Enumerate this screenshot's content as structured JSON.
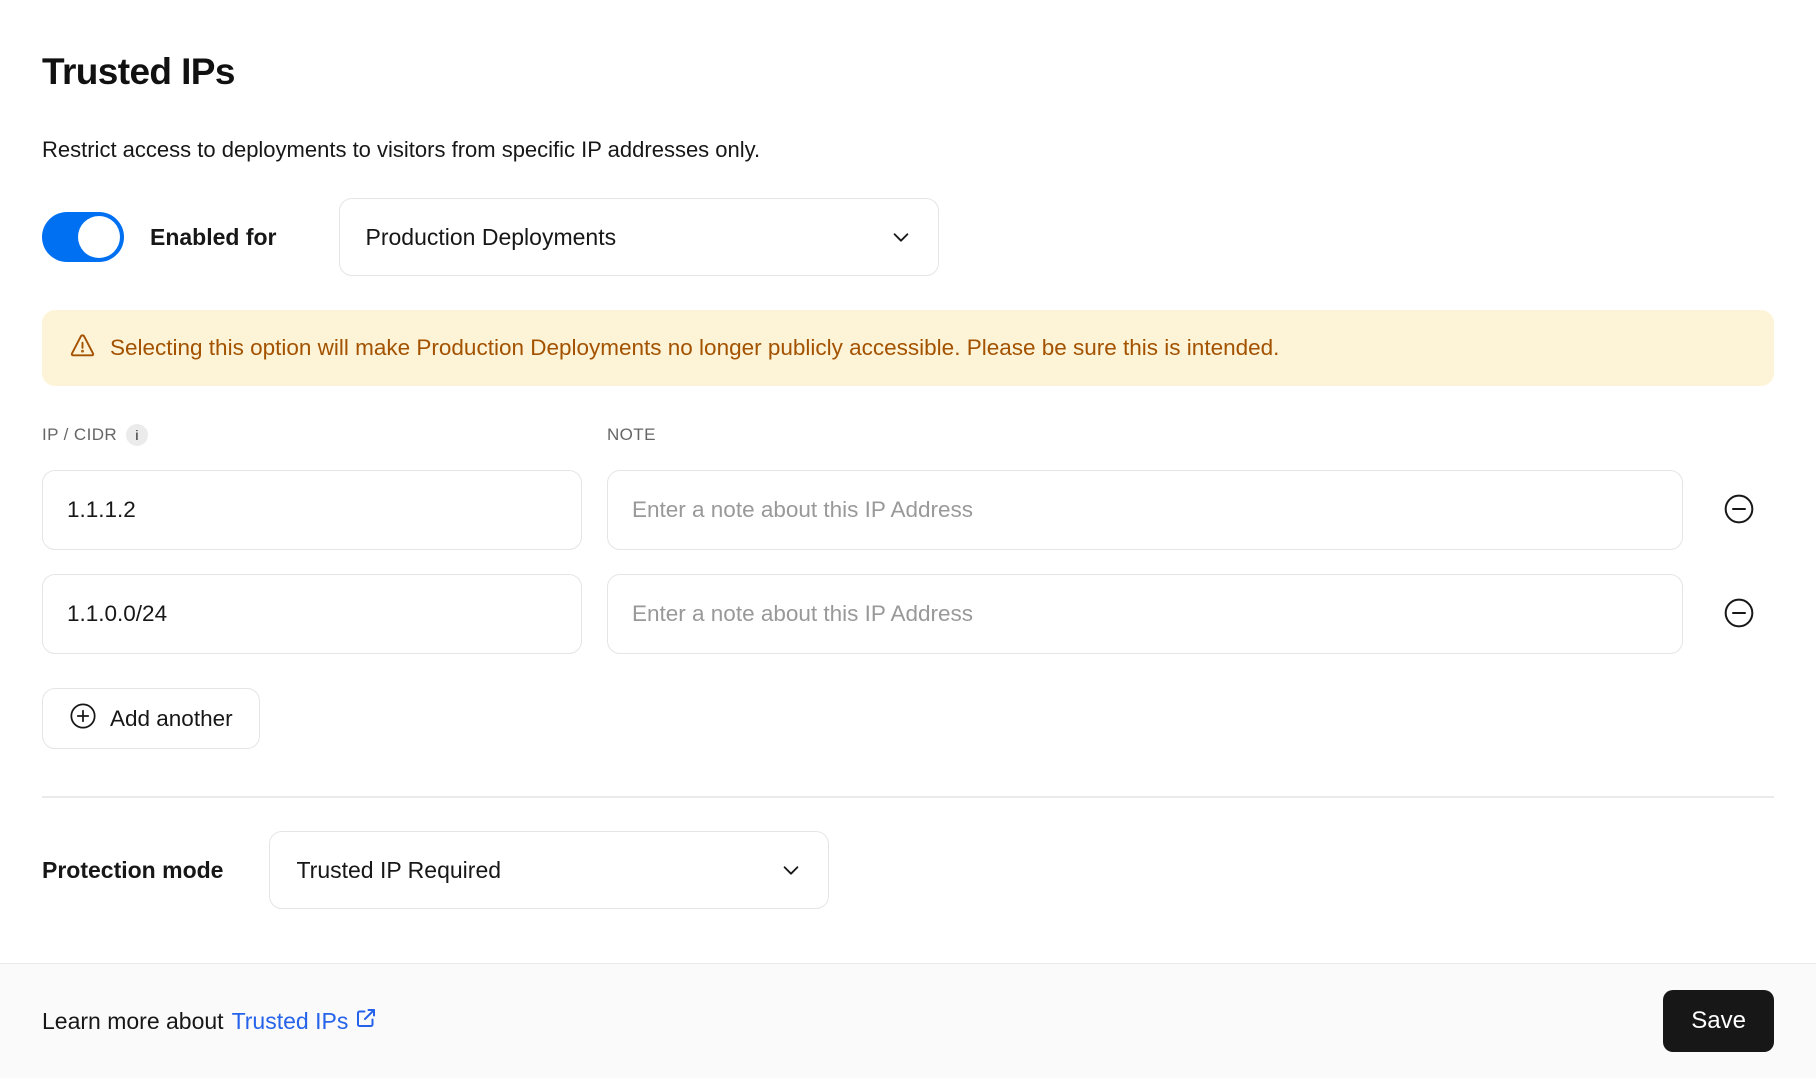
{
  "header": {
    "title": "Trusted IPs",
    "description": "Restrict access to deployments to visitors from specific IP addresses only."
  },
  "enabled_row": {
    "toggle_on": true,
    "label": "Enabled for",
    "select_value": "Production Deployments"
  },
  "warning": {
    "text": "Selecting this option will make Production Deployments no longer publicly accessible. Please be sure this is intended."
  },
  "ip_table": {
    "ip_header": "IP / CIDR",
    "info_glyph": "i",
    "note_header": "NOTE",
    "note_placeholder": "Enter a note about this IP Address",
    "rows": [
      {
        "ip": "1.1.1.2"
      },
      {
        "ip": "1.1.0.0/24"
      }
    ],
    "add_button_label": "Add another"
  },
  "protection": {
    "label": "Protection mode",
    "select_value": "Trusted IP Required"
  },
  "footer": {
    "learn_more_prefix": "Learn more about",
    "link_label": "Trusted IPs",
    "save_label": "Save"
  },
  "icons": {
    "toggle": "switch-on",
    "warning": "alert-triangle-outline",
    "info": "info-circle",
    "remove": "minus-circle-outline",
    "add": "plus-circle-outline",
    "select": "chevron-down",
    "link": "external-link"
  },
  "colors": {
    "toggle_on": "#0070F3",
    "link_blue": "#2563EB",
    "warning_bg": "#FDF3D7",
    "warning_text": "#A35200",
    "save_bg": "#171717",
    "border": "#E5E5E5",
    "muted_text": "#666666",
    "placeholder": "#999999",
    "footer_bg": "#FAFAFA"
  }
}
